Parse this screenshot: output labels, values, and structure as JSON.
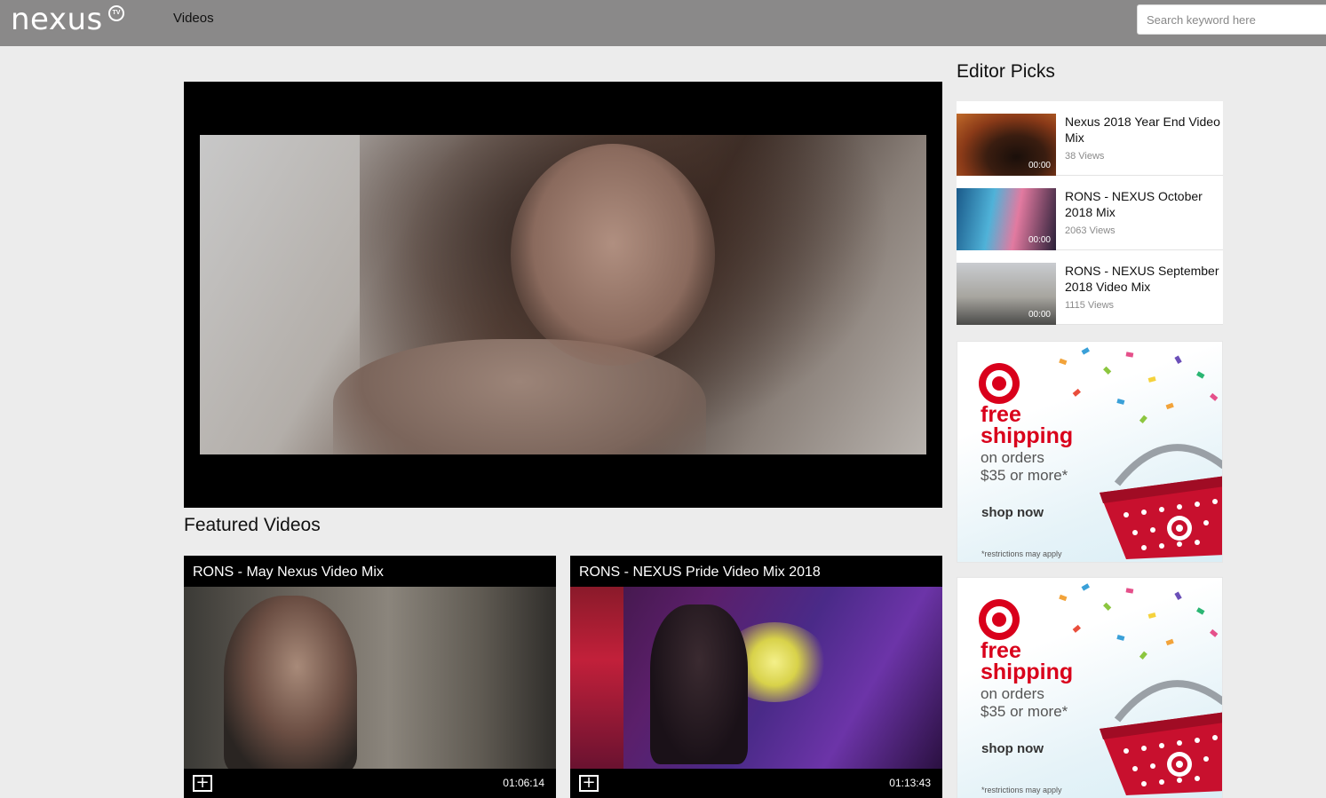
{
  "header": {
    "logo_text": "nexus",
    "logo_badge": "TV",
    "nav_videos": "Videos",
    "search_placeholder": "Search keyword here"
  },
  "featured": {
    "title": "Featured Videos",
    "videos": [
      {
        "title": "RONS - May Nexus Video Mix",
        "duration": "01:06:14",
        "add_icon": "plus-square-icon"
      },
      {
        "title": "RONS - NEXUS Pride Video Mix 2018",
        "duration": "01:13:43",
        "add_icon": "plus-square-icon"
      }
    ]
  },
  "editor_picks": {
    "title": "Editor Picks",
    "items": [
      {
        "title": "Nexus 2018 Year End Video Mix",
        "duration": "00:00",
        "views": "38 Views"
      },
      {
        "title": "RONS - NEXUS October 2018 Mix",
        "duration": "00:00",
        "views": "2063 Views"
      },
      {
        "title": "RONS - NEXUS September 2018 Video Mix",
        "duration": "00:00",
        "views": "1115 Views"
      }
    ]
  },
  "ads": [
    {
      "line1": "free",
      "line2": "shipping",
      "line3": "on orders",
      "line4": "$35 or more*",
      "cta": "shop now",
      "note": "*restrictions may apply"
    },
    {
      "line1": "free",
      "line2": "shipping",
      "line3": "on orders",
      "line4": "$35 or more*",
      "cta": "shop now",
      "note": "*restrictions may apply"
    }
  ],
  "colors": {
    "header_bg": "#8a8989",
    "page_bg": "#ececec",
    "ad_red": "#d9001b"
  }
}
